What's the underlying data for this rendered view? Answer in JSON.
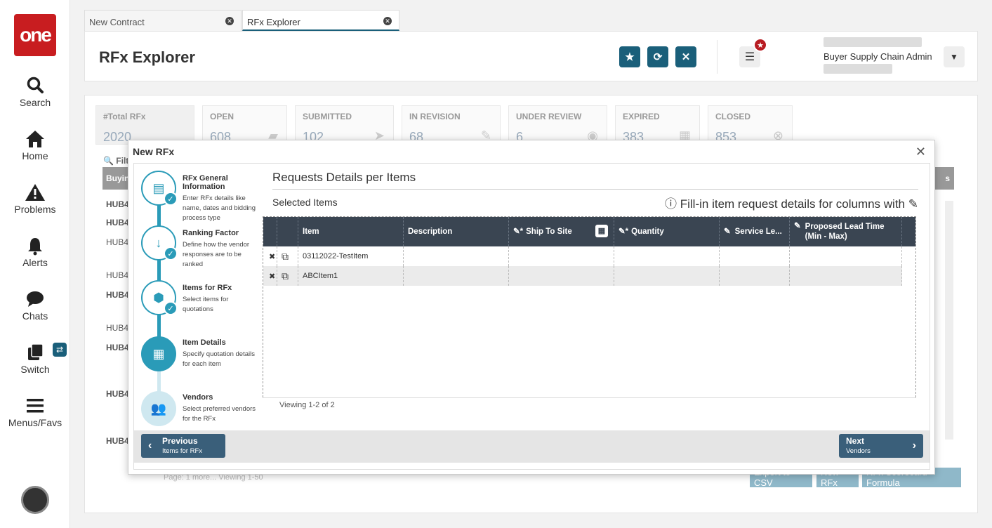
{
  "app": {
    "logo_text": "one"
  },
  "nav": [
    {
      "label": "Search",
      "icon": "search-icon"
    },
    {
      "label": "Home",
      "icon": "home-icon"
    },
    {
      "label": "Problems",
      "icon": "warning-icon"
    },
    {
      "label": "Alerts",
      "icon": "bell-icon"
    },
    {
      "label": "Chats",
      "icon": "chat-icon"
    },
    {
      "label": "Switch",
      "icon": "switch-icon"
    },
    {
      "label": "Menus/Favs",
      "icon": "menu-icon"
    }
  ],
  "tabs": [
    {
      "label": "New Contract"
    },
    {
      "label": "RFx Explorer"
    }
  ],
  "header": {
    "title": "RFx Explorer",
    "user_role": "Buyer Supply Chain Admin"
  },
  "stats": [
    {
      "label": "#Total RFx",
      "value": "2020"
    },
    {
      "label": "OPEN",
      "value": "608"
    },
    {
      "label": "SUBMITTED",
      "value": "102"
    },
    {
      "label": "IN REVISION",
      "value": "68"
    },
    {
      "label": "UNDER REVIEW",
      "value": "6"
    },
    {
      "label": "EXPIRED",
      "value": "383"
    },
    {
      "label": "CLOSED",
      "value": "853"
    }
  ],
  "background": {
    "filter_label": "Filt",
    "col_first": "Buyin",
    "col_last": "s",
    "rows": [
      "HUB4",
      "HUB4",
      "HUB4",
      "HUB4",
      "HUB4",
      "HUB4",
      "HUB4",
      "HUB4",
      "HUB4"
    ],
    "pager": "Page:   1   more...   Viewing 1-50",
    "buttons": [
      "Export to CSV",
      "New RFx",
      "RFx Scorecard Formula"
    ]
  },
  "modal": {
    "title": "New RFx",
    "steps": [
      {
        "title": "RFx General Information",
        "desc": "Enter RFx details like name, dates and bidding process type"
      },
      {
        "title": "Ranking Factor",
        "desc": "Define how the vendor responses are to be ranked"
      },
      {
        "title": "Items for RFx",
        "desc": "Select items for quotations"
      },
      {
        "title": "Item Details",
        "desc": "Specify quotation details for each item"
      },
      {
        "title": "Vendors",
        "desc": "Select preferred vendors for the RFx"
      }
    ],
    "section_title": "Requests Details per Items",
    "selected_items_label": "Selected Items",
    "fill_hint": "Fill-in item request details for columns with",
    "columns": {
      "item": "Item",
      "description": "Description",
      "ship_to_site": "Ship To Site",
      "quantity": "Quantity",
      "service_level": "Service Le...",
      "lead_time": "Proposed Lead Time (Min - Max)"
    },
    "rows": [
      {
        "item": "03112022-TestItem"
      },
      {
        "item": "ABCItem1"
      }
    ],
    "viewing": "Viewing 1-2 of 2",
    "prev": {
      "label": "Previous",
      "sub": "Items for RFx"
    },
    "next": {
      "label": "Next",
      "sub": "Vendors"
    }
  }
}
